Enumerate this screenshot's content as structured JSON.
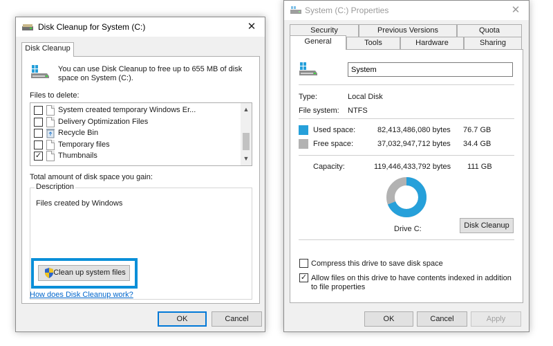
{
  "disk_cleanup": {
    "title": "Disk Cleanup for System (C:)",
    "close_glyph": "✕",
    "tab_label": "Disk Cleanup",
    "summary": "You can use Disk Cleanup to free up to 655 MB of disk space on System (C:).",
    "files_label": "Files to delete:",
    "files": [
      {
        "label": "System created temporary Windows Er...",
        "checked": false,
        "icon": "file-icon"
      },
      {
        "label": "Delivery Optimization Files",
        "checked": false,
        "icon": "file-icon"
      },
      {
        "label": "Recycle Bin",
        "checked": false,
        "icon": "recycle-bin-icon"
      },
      {
        "label": "Temporary files",
        "checked": false,
        "icon": "file-icon"
      },
      {
        "label": "Thumbnails",
        "checked": true,
        "icon": "file-icon"
      }
    ],
    "total_label": "Total amount of disk space you gain:",
    "description_label": "Description",
    "description_text": "Files created by Windows",
    "cleanup_system_button": "Clean up system files",
    "help_link": "How does Disk Cleanup work?",
    "ok_button": "OK",
    "cancel_button": "Cancel",
    "highlight_color": "#0a8fd8"
  },
  "properties": {
    "title": "System (C:) Properties",
    "close_glyph": "✕",
    "tabs_row1": [
      "Security",
      "Previous Versions",
      "Quota"
    ],
    "tabs_row2": [
      "General",
      "Tools",
      "Hardware",
      "Sharing"
    ],
    "active_tab": "General",
    "drive_name": "System",
    "type_label": "Type:",
    "type_value": "Local Disk",
    "fs_label": "File system:",
    "fs_value": "NTFS",
    "used_label": "Used space:",
    "used_bytes": "82,413,486,080 bytes",
    "used_gb": "76.7 GB",
    "free_label": "Free space:",
    "free_bytes": "37,032,947,712 bytes",
    "free_gb": "34.4 GB",
    "capacity_label": "Capacity:",
    "capacity_bytes": "119,446,433,792 bytes",
    "capacity_gb": "111 GB",
    "used_fraction": 0.69,
    "used_color": "#26a0da",
    "free_color": "#b2b2b2",
    "drive_label": "Drive C:",
    "disk_cleanup_button": "Disk Cleanup",
    "compress_label": "Compress this drive to save disk space",
    "compress_checked": false,
    "index_label": "Allow files on this drive to have contents indexed in addition to file properties",
    "index_checked": true,
    "ok_button": "OK",
    "cancel_button": "Cancel",
    "apply_button": "Apply"
  }
}
